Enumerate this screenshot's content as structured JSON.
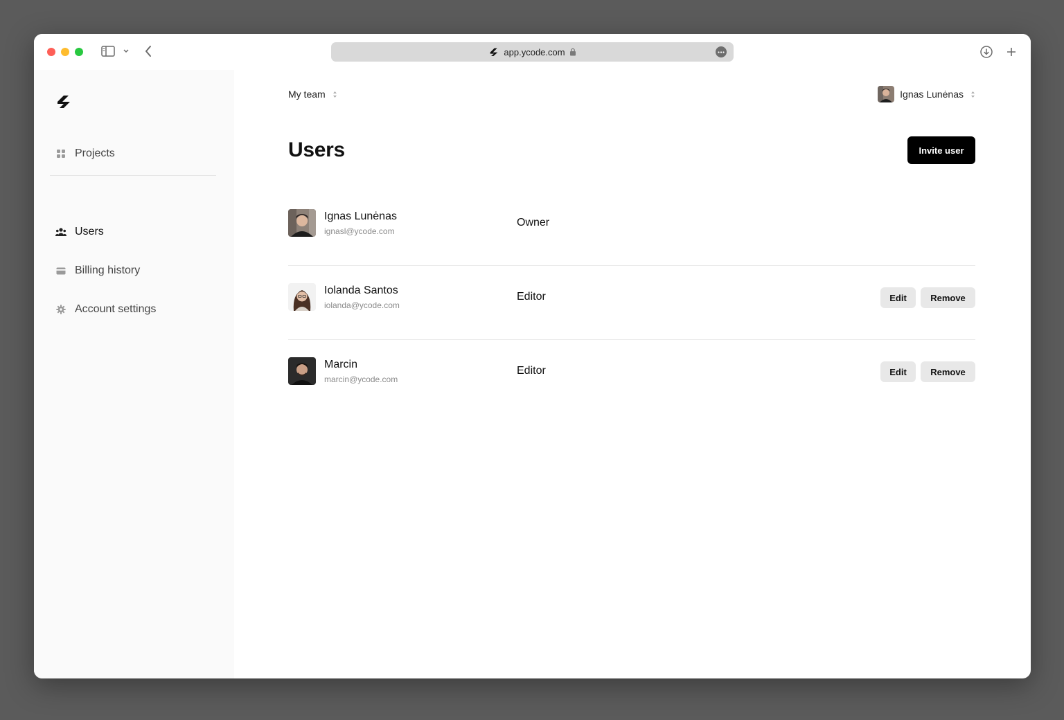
{
  "browser": {
    "url": "app.ycode.com"
  },
  "sidebar": {
    "items": [
      {
        "label": "Projects",
        "icon": "grid-icon"
      },
      {
        "label": "Users",
        "icon": "users-icon",
        "active": true
      },
      {
        "label": "Billing history",
        "icon": "card-icon"
      },
      {
        "label": "Account settings",
        "icon": "gear-icon"
      }
    ]
  },
  "header": {
    "team": "My team",
    "current_user": "Ignas Lunėnas"
  },
  "page": {
    "title": "Users",
    "invite_label": "Invite user"
  },
  "users": [
    {
      "name": "Ignas Lunėnas",
      "email": "ignasl@ycode.com",
      "role": "Owner"
    },
    {
      "name": "Iolanda Santos",
      "email": "iolanda@ycode.com",
      "role": "Editor",
      "edit_label": "Edit",
      "remove_label": "Remove"
    },
    {
      "name": "Marcin",
      "email": "marcin@ycode.com",
      "role": "Editor",
      "edit_label": "Edit",
      "remove_label": "Remove"
    }
  ],
  "colors": {
    "background": "#5b5b5b",
    "sidebar": "#fafafa",
    "primary_button": "#000000",
    "secondary_button": "#e8e8e8",
    "close": "#fe5f57",
    "minimize": "#febc2e",
    "zoom": "#28c840"
  }
}
